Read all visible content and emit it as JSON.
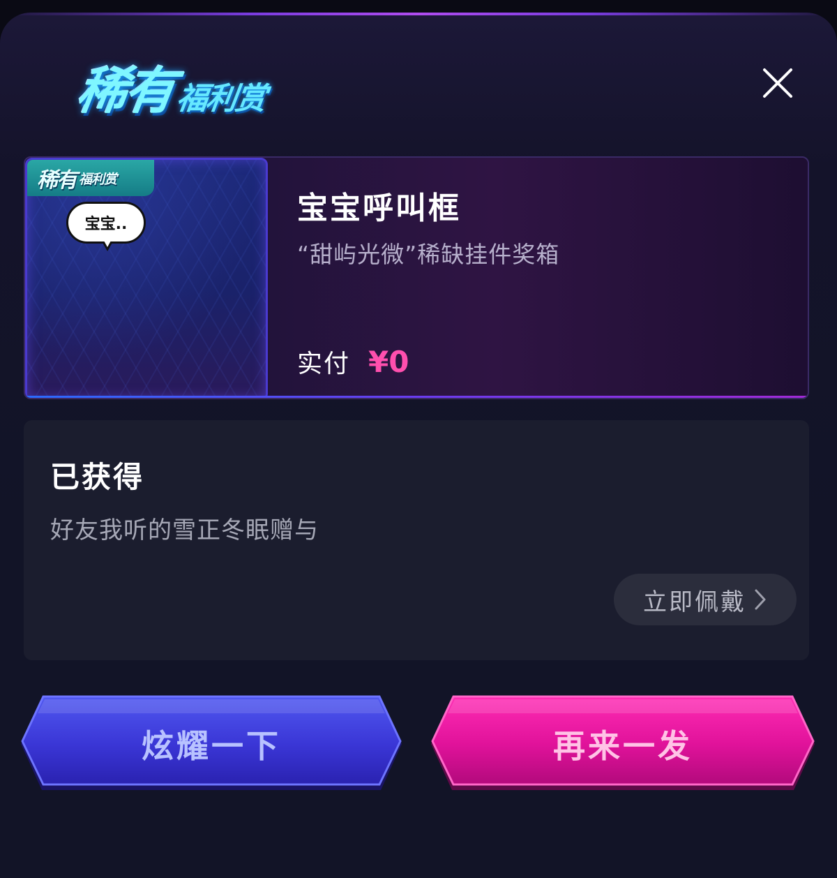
{
  "header": {
    "banner_big": "稀有",
    "banner_small": "福利赏",
    "close_icon": "close-icon"
  },
  "prize": {
    "tag_big": "稀有",
    "tag_small": "福利赏",
    "bubble_text": "宝宝..",
    "name": "宝宝呼叫框",
    "source": "“甜屿光微”稀缺挂件奖箱",
    "pay_label": "实付",
    "pay_value": "¥0"
  },
  "obtained": {
    "title": "已获得",
    "description": "好友我听的雪正冬眠赠与",
    "wear_button": "立即佩戴",
    "wear_icon": "chevron-right-icon"
  },
  "actions": {
    "share_label": "炫耀一下",
    "again_label": "再来一发"
  },
  "colors": {
    "accent_pink": "#ff4fae",
    "share_blue": "#3a3ad8",
    "again_pink": "#e0129a",
    "banner_cyan": "#7ff6ff"
  }
}
